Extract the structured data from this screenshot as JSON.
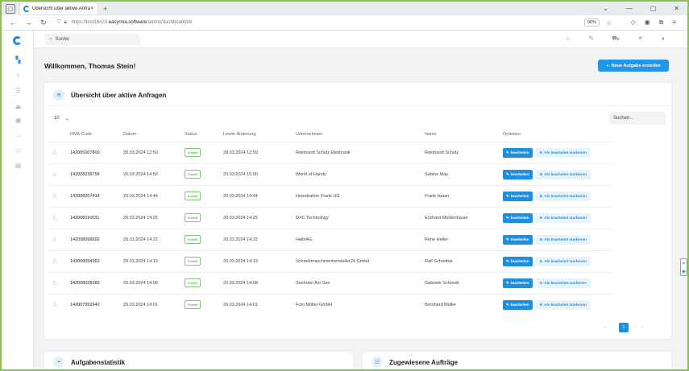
{
  "browser": {
    "tab_title": "Übersicht über aktive Anfragen",
    "url_prefix": "https://test16n23.",
    "url_domain": "easyrma.software",
    "url_path": "/admin/dashboard/de",
    "zoom": "90%"
  },
  "topbar": {
    "search_placeholder": "Suche"
  },
  "header": {
    "welcome": "Willkommen, Thomas Stein!",
    "new_task_button": "Neue Aufgabe erstellen"
  },
  "overview": {
    "title": "Übersicht über aktive Anfragen",
    "page_size": "10",
    "search_placeholder": "Suchen...",
    "columns": {
      "rma": "RMA-Code",
      "date": "Datum",
      "status": "Status",
      "last_change": "Letzte Änderung",
      "company": "Unternehmen",
      "name": "Name",
      "options": "Optionen"
    },
    "edit_label": "bearbeiten",
    "mark_label": "Als bearbeitet markieren",
    "rows": [
      {
        "rma": "142065007800",
        "date": "28.03.2024 12:50",
        "status": "Erstellt",
        "last_change": "28.03.2024 12:50",
        "company": "Reinhardt Schulz Elektronik",
        "name": "Reinhardt Schulz"
      },
      {
        "rma": "142008236796",
        "date": "20.03.2024 14:50",
        "status": "Erstellt",
        "last_change": "20.03.2024 15:00",
        "company": "World of Handy",
        "name": "Sabine May"
      },
      {
        "rma": "142008207414",
        "date": "20.03.2024 14:44",
        "status": "Erstellt",
        "last_change": "20.03.2024 14:44",
        "company": "Heizstrahler Frank UG",
        "name": "Frank Hauer"
      },
      {
        "rma": "142008116031",
        "date": "20.03.2024 14:25",
        "status": "Erstellt",
        "last_change": "20.03.2024 14:25",
        "company": "DXC Technology",
        "name": "Eckhard Moldenhauer"
      },
      {
        "rma": "142008096692",
        "date": "20.03.2024 14:22",
        "status": "Erstellt",
        "last_change": "20.03.2024 14:22",
        "company": "HalloAG",
        "name": "Rene Heller"
      },
      {
        "rma": "142008054362",
        "date": "20.03.2024 14:13",
        "status": "Erstellt",
        "last_change": "20.03.2024 14:13",
        "company": "Schreibmaschinenhersteller24 GmbH",
        "name": "Ralf Schreiber"
      },
      {
        "rma": "142008028383",
        "date": "20.03.2024 14:08",
        "status": "Erstellt",
        "last_change": "20.03.2024 14:08",
        "company": "Seehotel Am See",
        "name": "Gabriele Schmidt"
      },
      {
        "rma": "142007992942",
        "date": "20.03.2024 14:01",
        "status": "Erstellt",
        "last_change": "20.03.2024 14:01",
        "company": "Foto Müller GmbH",
        "name": "Bernhard Müller"
      }
    ],
    "current_page": "1"
  },
  "cards": {
    "stats_title": "Aufgabenstatistik",
    "assigned_title": "Zugewiesene Aufträge"
  },
  "colors": {
    "accent": "#2496e8",
    "status_green": "#3c9a36"
  }
}
